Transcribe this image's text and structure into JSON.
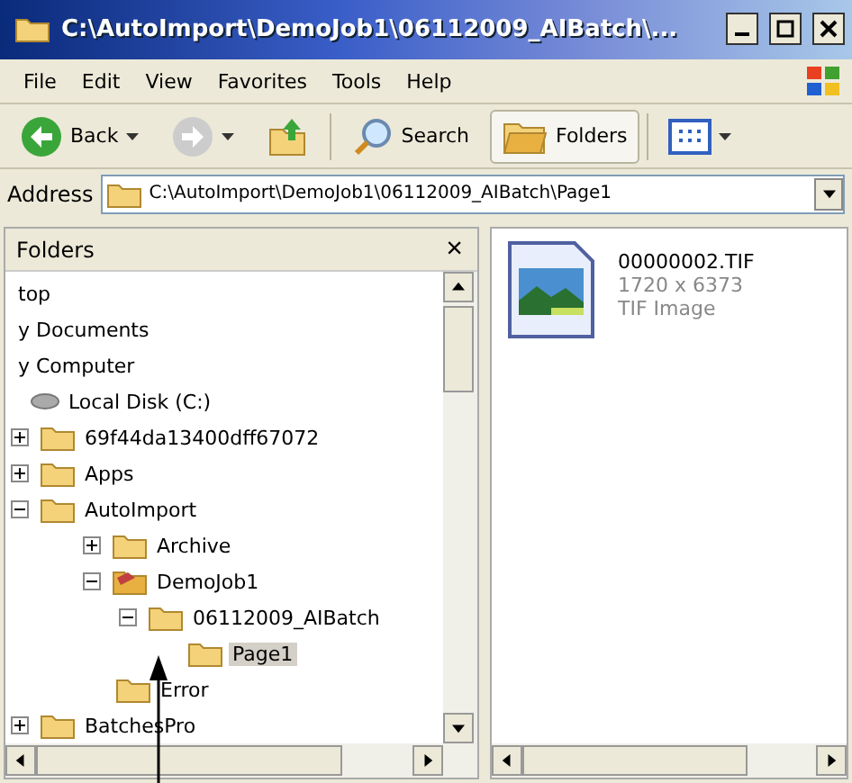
{
  "window": {
    "title": "C:\\AutoImport\\DemoJob1\\06112009_AIBatch\\..."
  },
  "menu": [
    "File",
    "Edit",
    "View",
    "Favorites",
    "Tools",
    "Help"
  ],
  "toolbar": [
    {
      "kind": "back",
      "label": "Back"
    },
    {
      "kind": "forward"
    },
    {
      "kind": "up"
    },
    {
      "kind": "search",
      "label": "Search",
      "pressed": false
    },
    {
      "kind": "folders",
      "label": "Folders",
      "pressed": true
    },
    {
      "kind": "views"
    }
  ],
  "address": {
    "label": "Address",
    "value": "C:\\AutoImport\\DemoJob1\\06112009_AIBatch\\Page1"
  },
  "folders_pane": {
    "title": "Folders",
    "close": "×",
    "tree": [
      {
        "label": "top",
        "kind": "plain",
        "selected": false
      },
      {
        "label": "y Documents",
        "kind": "plain",
        "selected": false
      },
      {
        "label": "y Computer",
        "kind": "plain",
        "selected": false
      },
      {
        "label": "Local Disk (C:)",
        "kind": "drive",
        "selected": false,
        "children": [
          {
            "label": "69f44da13400dff67072",
            "kind": "folder",
            "expanded": false,
            "selected": false
          },
          {
            "label": "Apps",
            "kind": "folder",
            "expanded": false,
            "selected": false
          },
          {
            "label": "AutoImport",
            "kind": "folder",
            "expanded": true,
            "selected": false,
            "children": [
              {
                "label": "Archive",
                "kind": "folder",
                "expanded": false,
                "selected": false
              },
              {
                "label": "DemoJob1",
                "kind": "job",
                "expanded": true,
                "selected": false,
                "children": [
                  {
                    "label": "06112009_AIBatch",
                    "kind": "folder",
                    "expanded": true,
                    "selected": false,
                    "children": [
                      {
                        "label": "Page1",
                        "kind": "folder",
                        "selected": true
                      }
                    ]
                  }
                ]
              },
              {
                "label": "Error",
                "kind": "folder",
                "selected": false
              }
            ]
          },
          {
            "label": "BatchesPro",
            "kind": "folder",
            "expanded": false,
            "selected": false
          }
        ]
      }
    ]
  },
  "files": [
    {
      "name": "00000002.TIF",
      "dimensions": "1720 x 6373",
      "type": "TIF Image"
    }
  ]
}
